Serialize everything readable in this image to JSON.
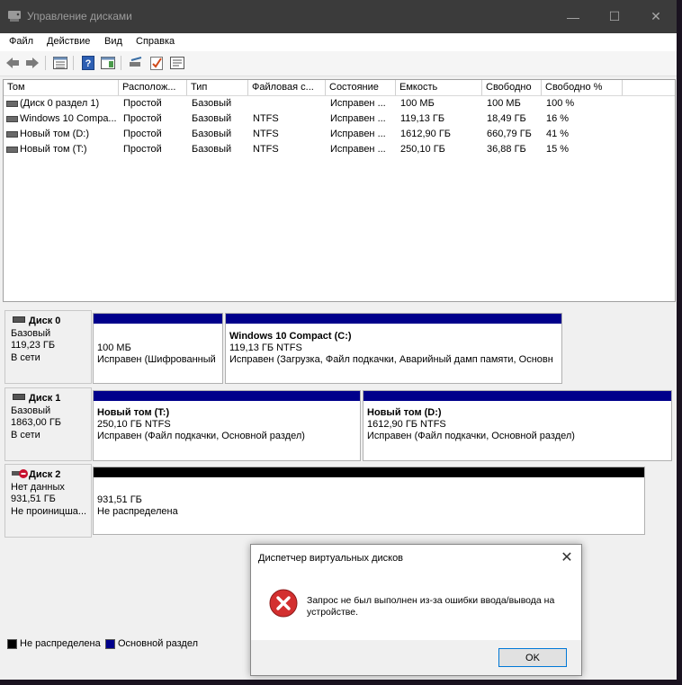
{
  "window": {
    "title": "Управление дисками",
    "minimize": "—",
    "maximize": "☐",
    "close": "✕"
  },
  "menu": [
    "Файл",
    "Действие",
    "Вид",
    "Справка"
  ],
  "toolbar": [
    "back-icon",
    "forward-icon",
    "properties-icon",
    "help-icon",
    "show-hide-icon",
    "connect-icon",
    "check-icon",
    "settings-icon"
  ],
  "columns": [
    "Том",
    "Располож...",
    "Тип",
    "Файловая с...",
    "Состояние",
    "Емкость",
    "Свободно",
    "Свободно %"
  ],
  "volumes": [
    [
      "(Диск 0 раздел 1)",
      "Простой",
      "Базовый",
      "",
      "Исправен ...",
      "100 МБ",
      "100 МБ",
      "100 %"
    ],
    [
      "Windows 10 Compa...",
      "Простой",
      "Базовый",
      "NTFS",
      "Исправен ...",
      "119,13 ГБ",
      "18,49 ГБ",
      "16 %"
    ],
    [
      "Новый том (D:)",
      "Простой",
      "Базовый",
      "NTFS",
      "Исправен ...",
      "1612,90 ГБ",
      "660,79 ГБ",
      "41 %"
    ],
    [
      "Новый том (T:)",
      "Простой",
      "Базовый",
      "NTFS",
      "Исправен ...",
      "250,10 ГБ",
      "36,88 ГБ",
      "15 %"
    ]
  ],
  "disks": [
    {
      "name": "Диск 0",
      "type": "Базовый",
      "size": "119,23 ГБ",
      "status": "В сети",
      "partitions": [
        {
          "title": "",
          "size": "100 МБ",
          "status": "Исправен (Шифрованный"
        },
        {
          "title": "Windows 10 Compact  (C:)",
          "size": "119,13 ГБ NTFS",
          "status": "Исправен (Загрузка, Файл подкачки, Аварийный дамп памяти, Основн"
        }
      ]
    },
    {
      "name": "Диск 1",
      "type": "Базовый",
      "size": "1863,00 ГБ",
      "status": "В сети",
      "partitions": [
        {
          "title": "Новый том  (T:)",
          "size": "250,10 ГБ NTFS",
          "status": "Исправен (Файл подкачки, Основной раздел)"
        },
        {
          "title": "Новый том  (D:)",
          "size": "1612,90 ГБ NTFS",
          "status": "Исправен (Файл подкачки, Основной раздел)"
        }
      ]
    },
    {
      "name": "Диск 2",
      "type": "Нет данных",
      "size": "931,51 ГБ",
      "status": "Не проиницша...",
      "partitions": [
        {
          "title": "",
          "size": "931,51 ГБ",
          "status": "Не распределена"
        }
      ]
    }
  ],
  "legend": [
    {
      "label": "Не распределена",
      "color": "#000000"
    },
    {
      "label": "Основной раздел",
      "color": "#00008b"
    }
  ],
  "dialog": {
    "title": "Диспетчер виртуальных дисков",
    "message": "Запрос не был выполнен из-за ошибки ввода/вывода на устройстве.",
    "ok": "OK"
  }
}
